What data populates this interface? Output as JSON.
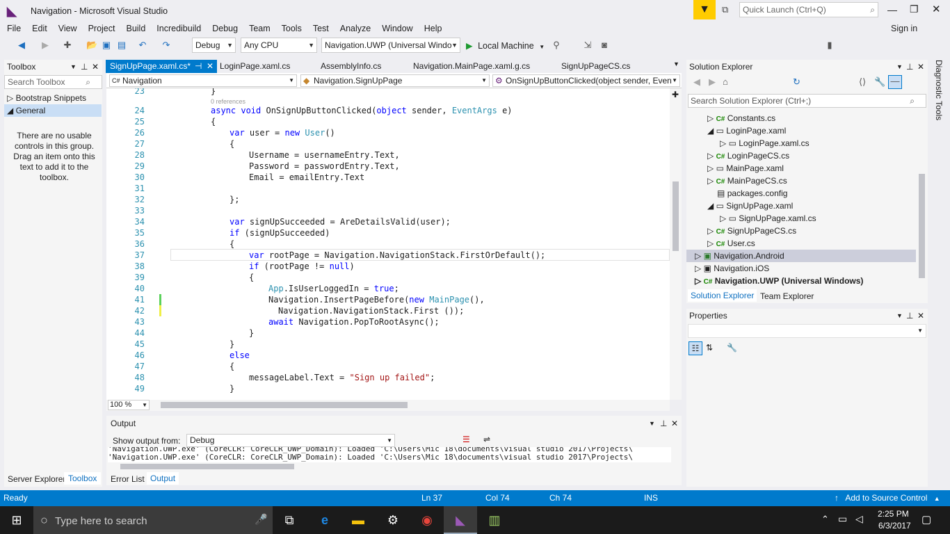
{
  "window": {
    "title": "Navigation - Microsoft Visual Studio",
    "quick_launch_placeholder": "Quick Launch (Ctrl+Q)",
    "sign_in": "Sign in"
  },
  "menu": [
    "File",
    "Edit",
    "View",
    "Project",
    "Build",
    "Incredibuild",
    "Debug",
    "Team",
    "Tools",
    "Test",
    "Analyze",
    "Window",
    "Help"
  ],
  "toolbar": {
    "config": "Debug",
    "platform": "Any CPU",
    "project": "Navigation.UWP (Universal Windo",
    "run_target": "Local Machine"
  },
  "toolbox": {
    "title": "Toolbox",
    "search_placeholder": "Search Toolbox",
    "group1": "Bootstrap Snippets",
    "group2": "General",
    "empty_msg": "There are no usable controls in this group. Drag an item onto this text to add it to the toolbox.",
    "tab_server": "Server Explorer",
    "tab_toolbox": "Toolbox"
  },
  "editor": {
    "tabs": [
      "SignUpPage.xaml.cs*",
      "LoginPage.xaml.cs",
      "AssemblyInfo.cs",
      "Navigation.MainPage.xaml.g.cs",
      "SignUpPageCS.cs"
    ],
    "nav_project": "Navigation",
    "nav_class": "Navigation.SignUpPage",
    "nav_member": "OnSignUpButtonClicked(object sender, Event",
    "zoom": "100 %",
    "references": "0 references"
  },
  "output": {
    "title": "Output",
    "show_from_label": "Show output from:",
    "source": "Debug",
    "line1": "'Navigation.UWP.exe' (CoreCLR: CoreCLR_UWP_Domain): Loaded 'C:\\Users\\Mic 18\\documents\\visual studio 2017\\Projects\\",
    "line2": "'Navigation.UWP.exe' (CoreCLR: CoreCLR_UWP_Domain): Loaded 'C:\\Users\\Mic 18\\documents\\visual studio 2017\\Projects\\",
    "tab_errors": "Error List",
    "tab_output": "Output"
  },
  "solution": {
    "title": "Solution Explorer",
    "search_placeholder": "Search Solution Explorer (Ctrl+;)",
    "items": [
      "Constants.cs",
      "LoginPage.xaml",
      "LoginPage.xaml.cs",
      "LoginPageCS.cs",
      "MainPage.xaml",
      "MainPageCS.cs",
      "packages.config",
      "SignUpPage.xaml",
      "SignUpPage.xaml.cs",
      "SignUpPageCS.cs",
      "User.cs",
      "Navigation.Android",
      "Navigation.iOS",
      "Navigation.UWP (Universal Windows)"
    ],
    "tab_solution": "Solution Explorer",
    "tab_team": "Team Explorer"
  },
  "properties": {
    "title": "Properties"
  },
  "diagnostic": "Diagnostic Tools",
  "status": {
    "ready": "Ready",
    "ln": "Ln 37",
    "col": "Col 74",
    "ch": "Ch 74",
    "ins": "INS",
    "source_control": "Add to Source Control"
  },
  "taskbar": {
    "search_placeholder": "Type here to search",
    "time": "2:25 PM",
    "date": "6/3/2017"
  },
  "code_lines": {
    "n23": "23",
    "n24": "24",
    "n25": "25",
    "n26": "26",
    "n27": "27",
    "n28": "28",
    "n29": "29",
    "n30": "30",
    "n31": "31",
    "n32": "32",
    "n33": "33",
    "n34": "34",
    "n35": "35",
    "n36": "36",
    "n37": "37",
    "n38": "38",
    "n39": "39",
    "n40": "40",
    "n41": "41",
    "n42": "42",
    "n43": "43",
    "n44": "44",
    "n45": "45",
    "n46": "46",
    "n47": "47",
    "n48": "48",
    "n49": "49"
  }
}
